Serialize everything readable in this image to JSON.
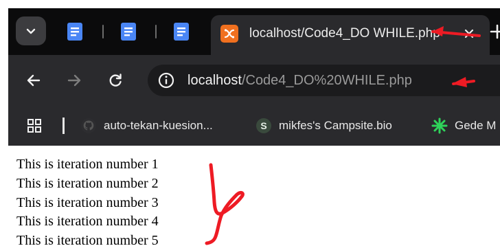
{
  "browser": {
    "tabs": {
      "active_title": "localhost/Code4_DO WHILE.php",
      "close_glyph": "×",
      "new_tab_glyph": "+"
    },
    "omnibox": {
      "host": "localhost",
      "path": "/Code4_DO%20WHILE.php"
    },
    "bookmarks": [
      {
        "label": "auto-tekan-kuesion...",
        "icon": "github-icon"
      },
      {
        "label": "mikfes's Campsite.bio",
        "icon": "campsite-icon"
      },
      {
        "label": "Gede M",
        "icon": "sparkle-icon"
      }
    ]
  },
  "page": {
    "lines": [
      "This is iteration number 1",
      "This is iteration number 2",
      "This is iteration number 3",
      "This is iteration number 4",
      "This is iteration number 5"
    ]
  },
  "colors": {
    "annotation": "#ee1b24",
    "docs_blue": "#4a86f5",
    "xampp_orange": "#f0701f",
    "chrome_dark": "#0b0b0c",
    "toolbar": "#2a2a2d"
  }
}
